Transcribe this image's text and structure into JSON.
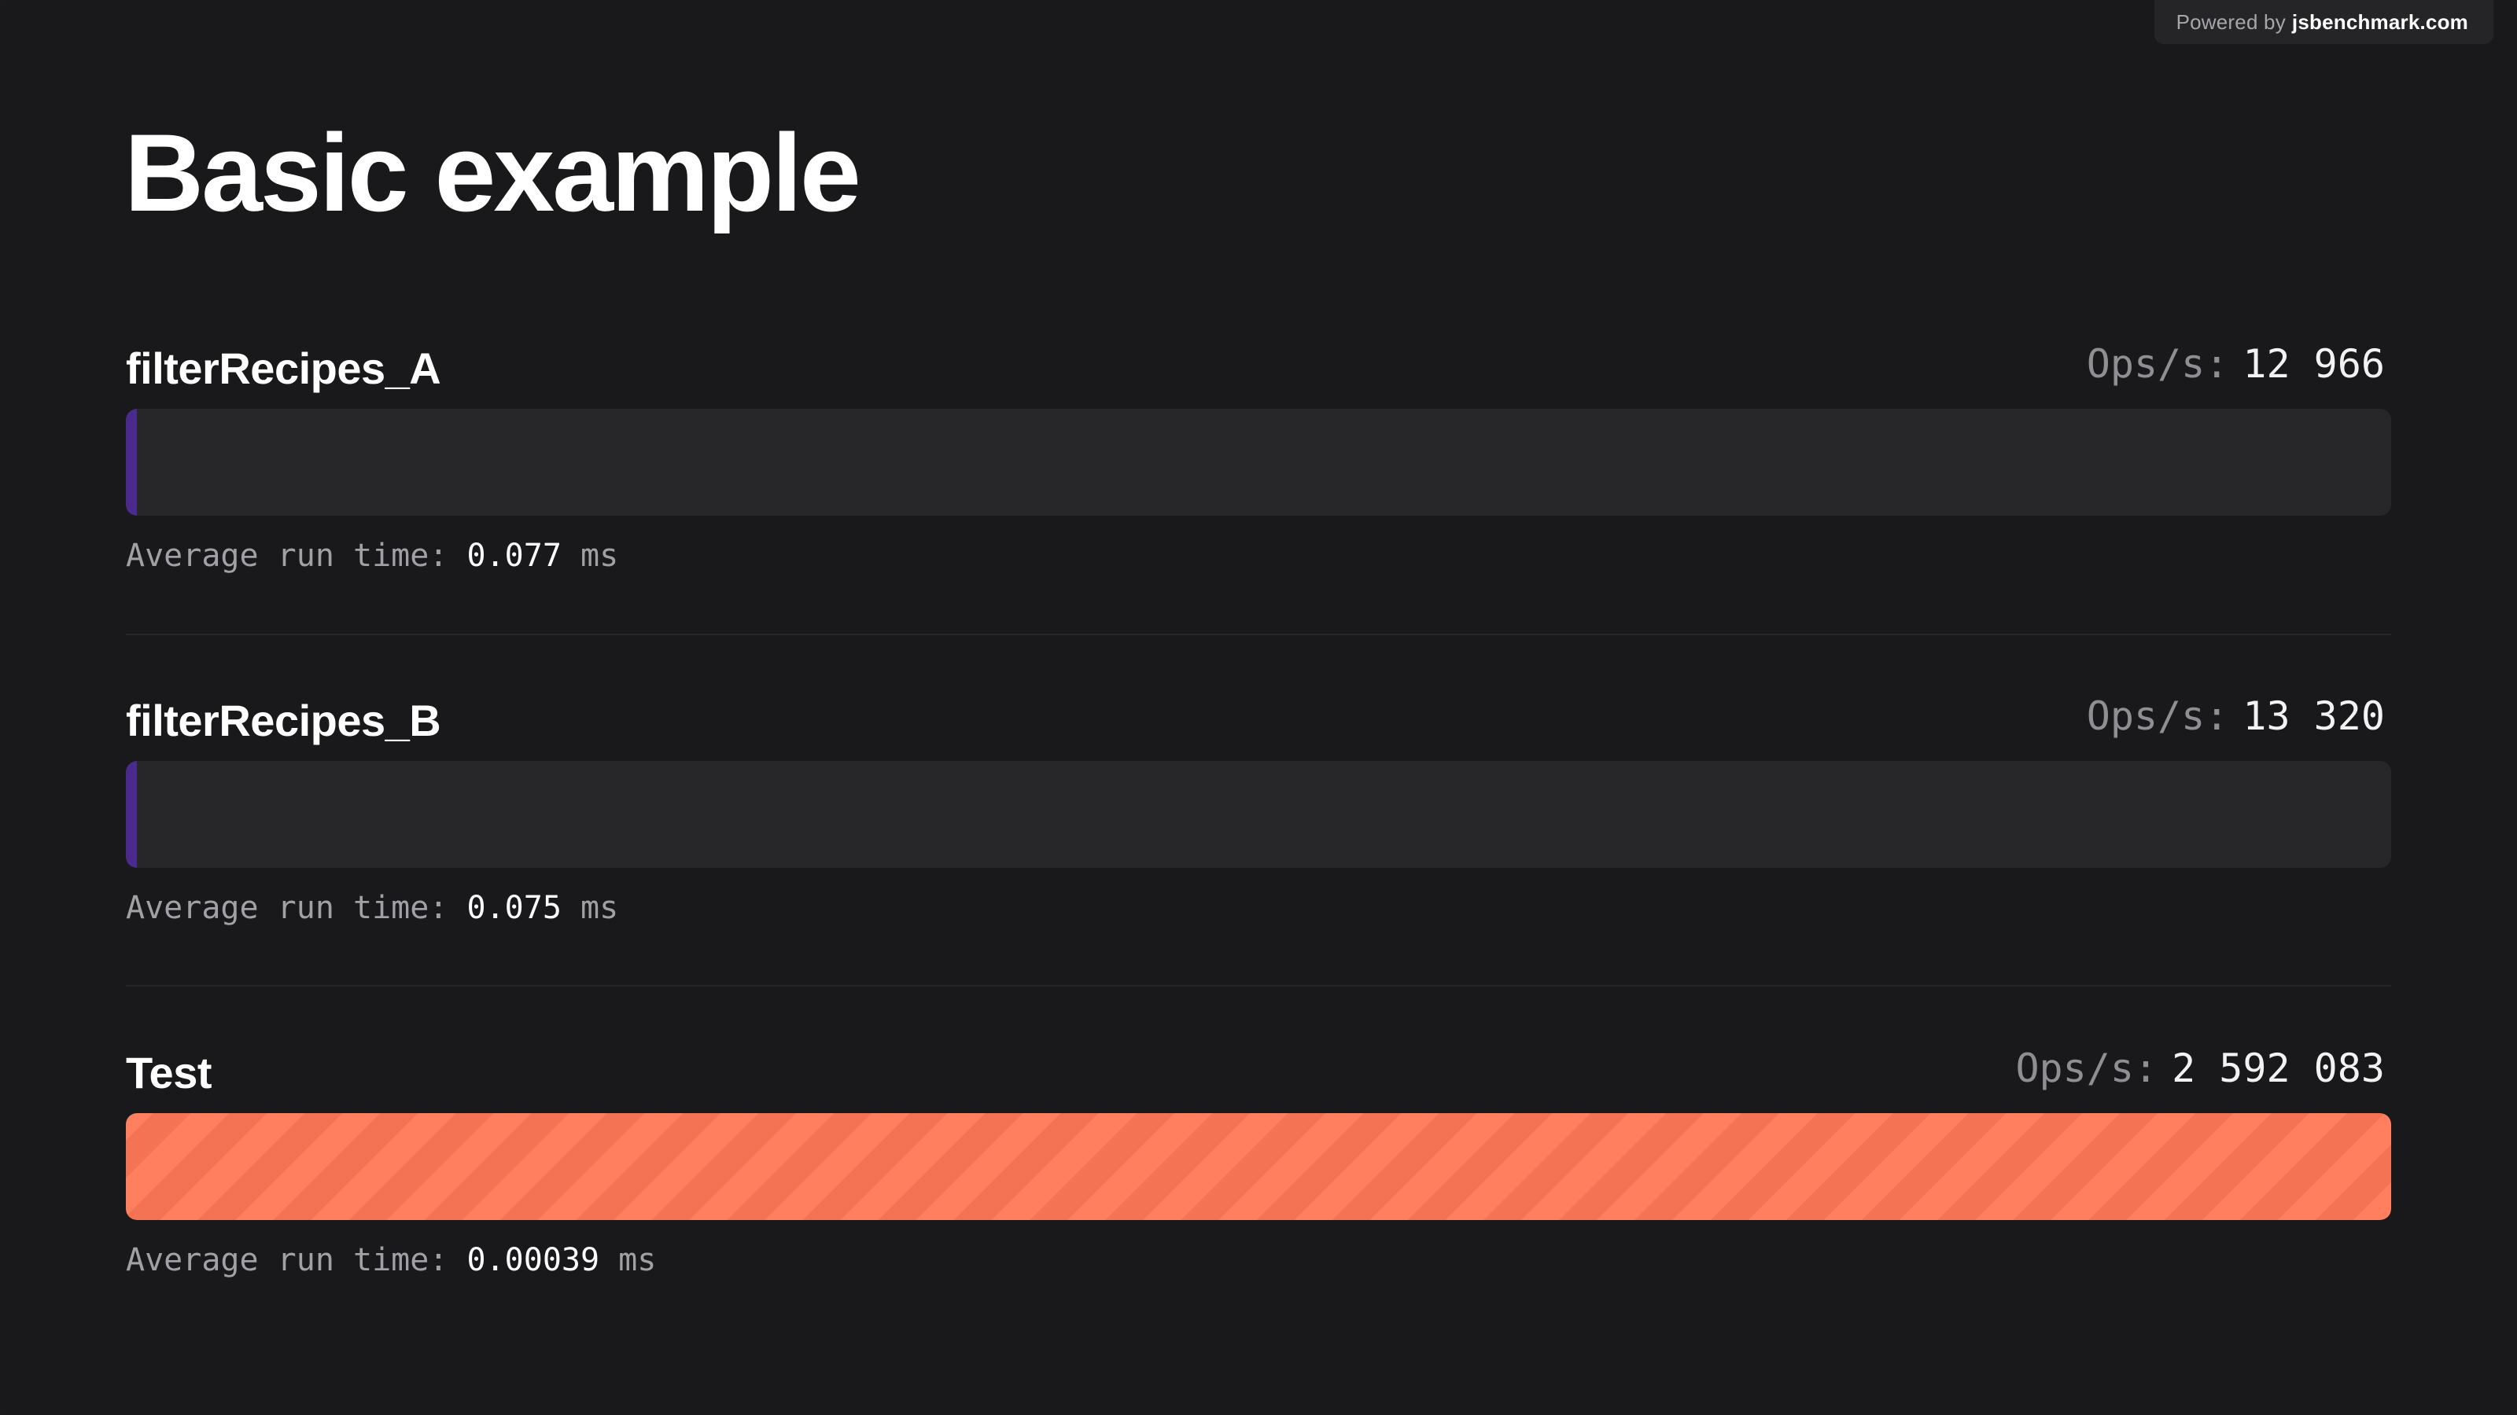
{
  "powered_by": {
    "prefix": "Powered by",
    "brand": "jsbenchmark.com"
  },
  "title": "Basic example",
  "labels": {
    "ops": "Ops/s:",
    "avg": "Average run time:",
    "unit": "ms"
  },
  "benchmarks": [
    {
      "name": "filterRecipes_A",
      "ops": "12 966",
      "avg_time": "0.077",
      "relative": 0.005,
      "color": "#4a2a8c"
    },
    {
      "name": "filterRecipes_B",
      "ops": "13 320",
      "avg_time": "0.075",
      "relative": 0.005,
      "color": "#4a2a8c"
    },
    {
      "name": "Test",
      "ops": "2 592 083",
      "avg_time": "0.00039",
      "relative": 1.0,
      "color": "#ff7f5e"
    }
  ]
}
